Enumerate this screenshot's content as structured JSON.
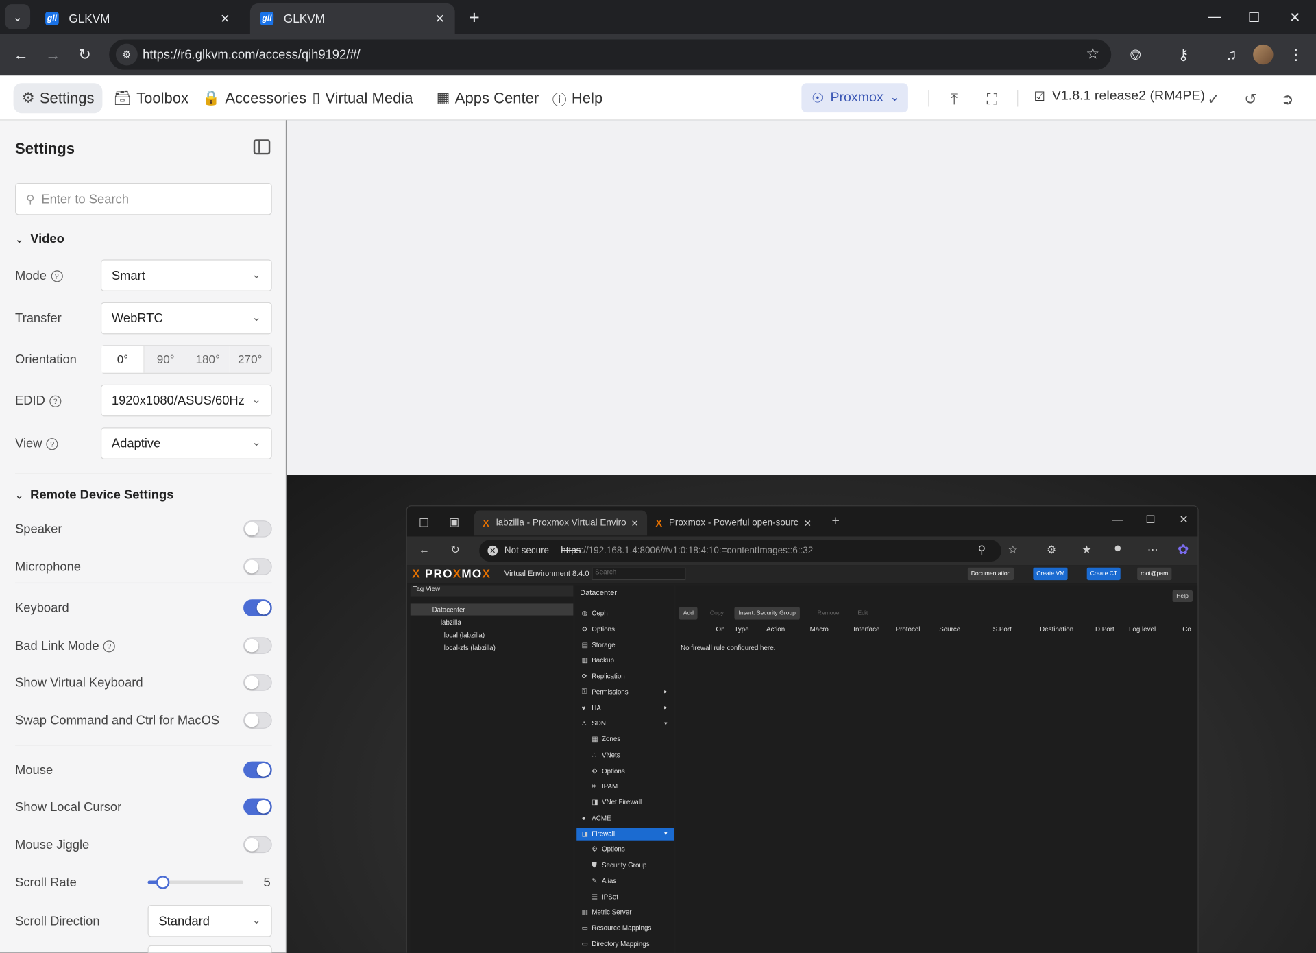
{
  "browser": {
    "tabs": [
      {
        "title": "GLKVM",
        "favicon": "gli"
      },
      {
        "title": "GLKVM",
        "favicon": "gli"
      }
    ],
    "url": "https://r6.glkvm.com/access/qih9192/#/"
  },
  "app_nav": {
    "settings": "Settings",
    "toolbox": "Toolbox",
    "accessories": "Accessories",
    "virtual_media": "Virtual Media",
    "apps_center": "Apps Center",
    "help": "Help",
    "device": "Proxmox",
    "version": "V1.8.1 release2 (RM4PE)"
  },
  "sidebar": {
    "title": "Settings",
    "search_placeholder": "Enter to Search",
    "video": {
      "header": "Video",
      "mode_label": "Mode",
      "mode_value": "Smart",
      "transfer_label": "Transfer",
      "transfer_value": "WebRTC",
      "orientation_label": "Orientation",
      "orientation_options": [
        "0°",
        "90°",
        "180°",
        "270°"
      ],
      "orientation_selected": "0°",
      "edid_label": "EDID",
      "edid_value": "1920x1080/ASUS/60Hz",
      "view_label": "View",
      "view_value": "Adaptive"
    },
    "remote": {
      "header": "Remote Device Settings",
      "speaker": {
        "label": "Speaker",
        "on": false
      },
      "microphone": {
        "label": "Microphone",
        "on": false
      },
      "keyboard": {
        "label": "Keyboard",
        "on": true
      },
      "bad_link": {
        "label": "Bad Link Mode",
        "on": false
      },
      "virtual_keyboard": {
        "label": "Show Virtual Keyboard",
        "on": false
      },
      "swap_cmd": {
        "label": "Swap Command and Ctrl for MacOS",
        "on": false
      },
      "mouse": {
        "label": "Mouse",
        "on": true
      },
      "local_cursor": {
        "label": "Show Local Cursor",
        "on": true
      },
      "jiggle": {
        "label": "Mouse Jiggle",
        "on": false
      },
      "scroll_rate_label": "Scroll Rate",
      "scroll_rate_value": "5",
      "scroll_rate_fraction": 0.16,
      "scroll_direction_label": "Scroll Direction",
      "scroll_direction_value": "Standard"
    }
  },
  "remote_screen": {
    "tabs": [
      "labzilla - Proxmox Virtual Environ",
      "Proxmox - Powerful open-source"
    ],
    "not_secure": "Not secure",
    "url_scheme": "https",
    "url_rest": "://192.168.1.4:8006/#v1:0:18:4:10:=contentImages::6::32",
    "pve_logo_a": "PRO",
    "pve_logo_x": "X",
    "pve_logo_b": "MO",
    "pve_logo_c": "X",
    "pve_version": "Virtual Environment 8.4.0",
    "search_placeholder": "Search",
    "buttons": {
      "documentation": "Documentation",
      "create_vm": "Create VM",
      "create_ct": "Create CT",
      "user": "root@pam"
    },
    "tree_header": "Tag View",
    "tree": [
      "Datacenter",
      "labzilla",
      "local (labzilla)",
      "local-zfs (labzilla)"
    ],
    "crumb": "Datacenter",
    "help": "Help",
    "menu": [
      {
        "label": "Ceph",
        "sub": false
      },
      {
        "label": "Options",
        "sub": false
      },
      {
        "label": "Storage",
        "sub": false
      },
      {
        "label": "Backup",
        "sub": false
      },
      {
        "label": "Replication",
        "sub": false
      },
      {
        "label": "Permissions",
        "sub": false,
        "arrow": "▸"
      },
      {
        "label": "HA",
        "sub": false,
        "arrow": "▸"
      },
      {
        "label": "SDN",
        "sub": false,
        "arrow": "▾"
      },
      {
        "label": "Zones",
        "sub": true
      },
      {
        "label": "VNets",
        "sub": true
      },
      {
        "label": "Options",
        "sub": true
      },
      {
        "label": "IPAM",
        "sub": true
      },
      {
        "label": "VNet Firewall",
        "sub": true
      },
      {
        "label": "ACME",
        "sub": false
      },
      {
        "label": "Firewall",
        "sub": false,
        "arrow": "▾",
        "selected": true
      },
      {
        "label": "Options",
        "sub": true
      },
      {
        "label": "Security Group",
        "sub": true
      },
      {
        "label": "Alias",
        "sub": true
      },
      {
        "label": "IPSet",
        "sub": true
      },
      {
        "label": "Metric Server",
        "sub": false
      },
      {
        "label": "Resource Mappings",
        "sub": false
      },
      {
        "label": "Directory Mappings",
        "sub": false
      }
    ],
    "toolbar": [
      "Add",
      "Copy",
      "Insert: Security Group",
      "Remove",
      "Edit"
    ],
    "toolbar_enabled": [
      true,
      false,
      true,
      false,
      false
    ],
    "columns": [
      "On",
      "Type",
      "Action",
      "Macro",
      "Interface",
      "Protocol",
      "Source",
      "S.Port",
      "Destination",
      "D.Port",
      "Log level",
      "Co"
    ],
    "empty": "No firewall rule configured here."
  }
}
